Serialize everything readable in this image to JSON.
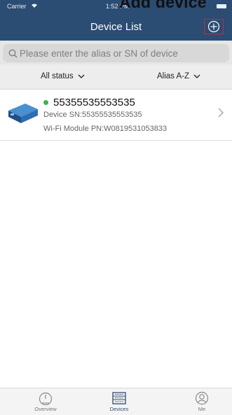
{
  "annotation": {
    "text": "Add device"
  },
  "status_bar": {
    "carrier": "Carrier",
    "time": "1:52 PM"
  },
  "header": {
    "title": "Device List"
  },
  "search": {
    "placeholder": "Please enter the alias or SN of device"
  },
  "filters": {
    "status": "All status",
    "sort": "Alias A-Z"
  },
  "devices": [
    {
      "alias": "55355535553535",
      "online": true,
      "sn_label": "Device SN:55355535553535",
      "pn_label": "Wi-Fi Module PN:W0819531053833"
    }
  ],
  "tabs": [
    {
      "label": "Overview",
      "icon": "gauge-icon"
    },
    {
      "label": "Devices",
      "icon": "device-rack-icon",
      "active": true
    },
    {
      "label": "Me",
      "icon": "user-icon"
    }
  ],
  "colors": {
    "header": "#2b4c73",
    "online": "#3cb54a",
    "highlight": "#c0312f"
  }
}
